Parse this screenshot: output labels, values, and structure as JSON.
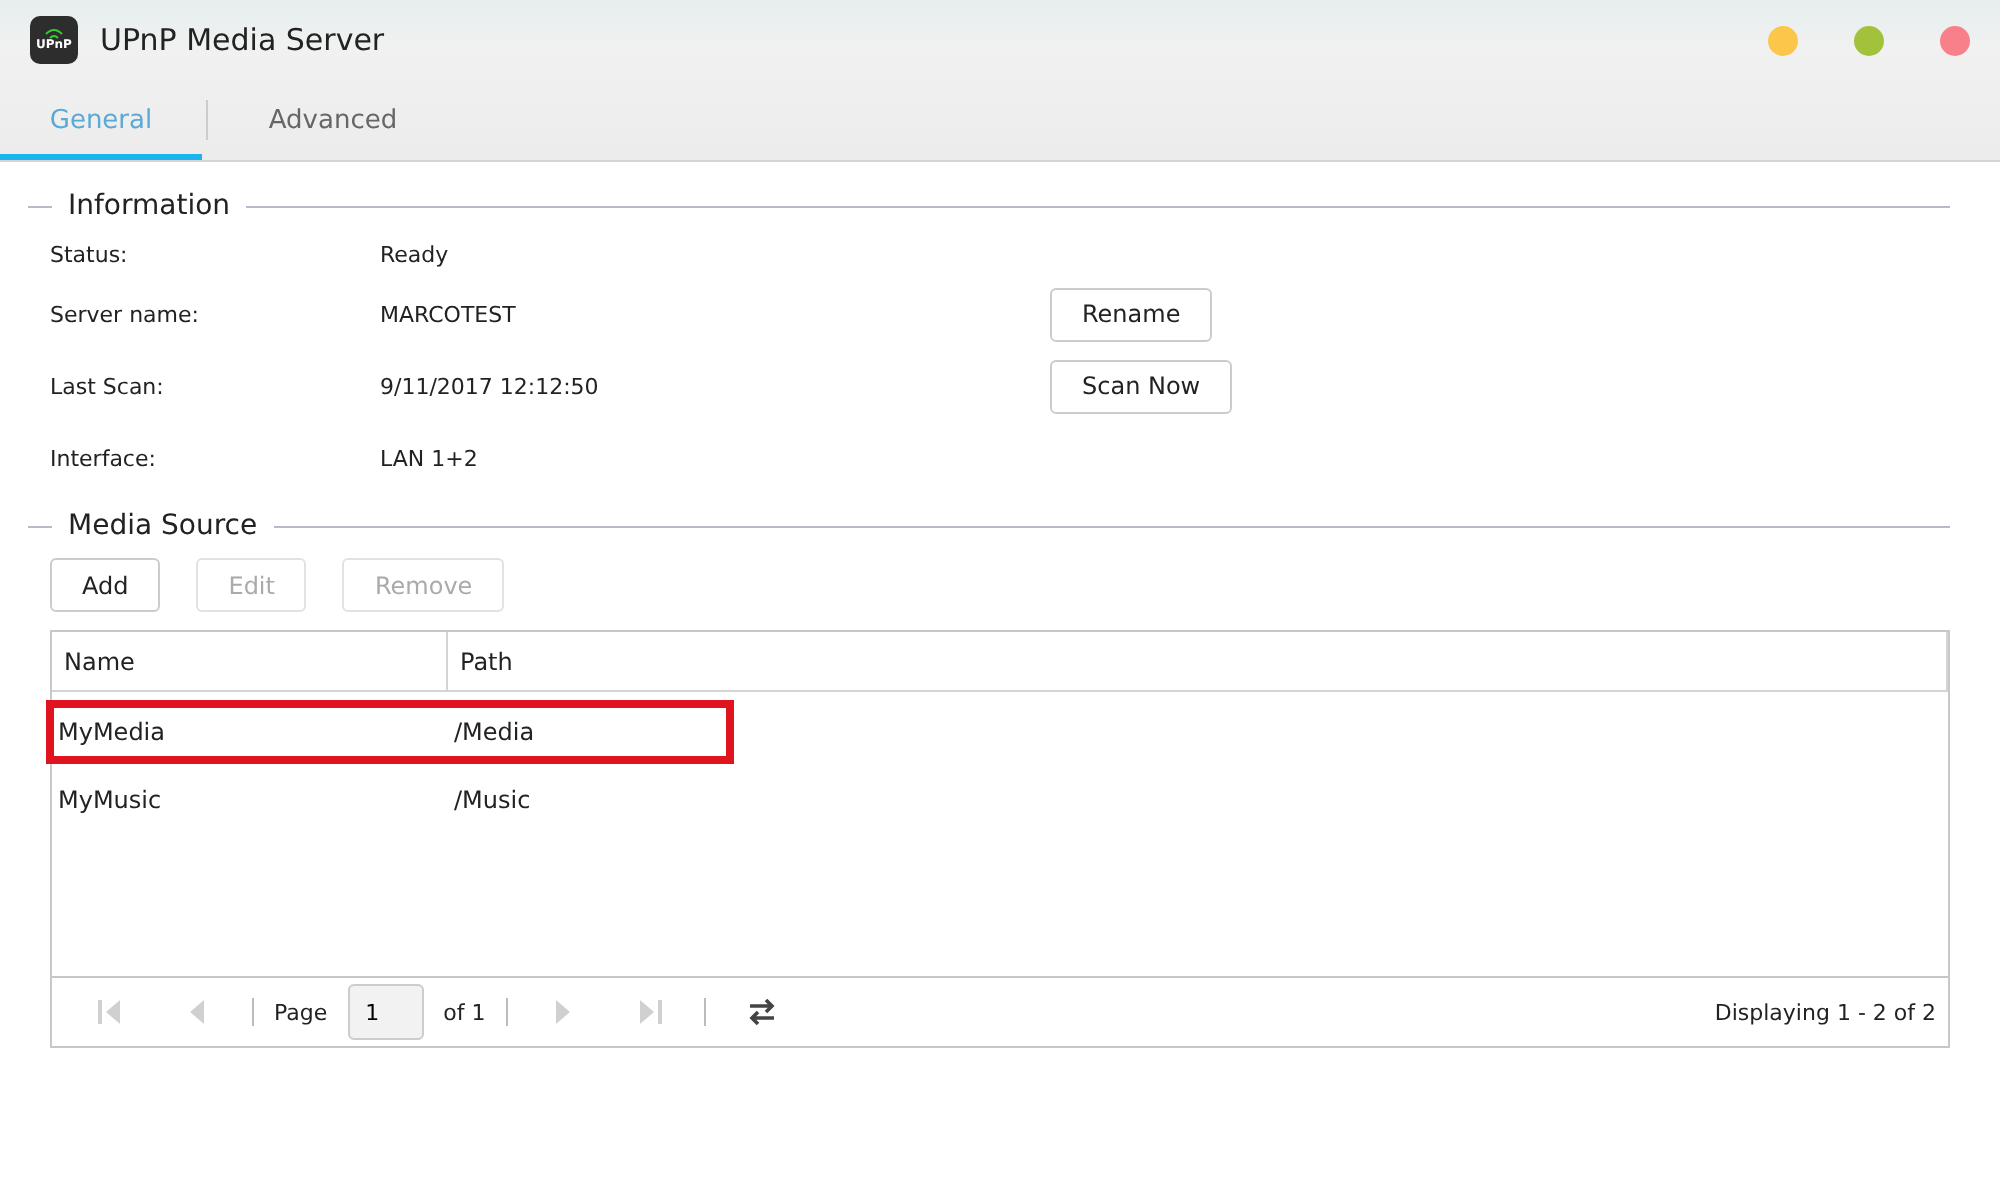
{
  "window": {
    "title": "UPnP Media Server",
    "app_icon_text": "UPnP"
  },
  "tabs": [
    {
      "label": "General",
      "selected": true
    },
    {
      "label": "Advanced",
      "selected": false
    }
  ],
  "information": {
    "title": "Information",
    "rows": [
      {
        "label": "Status:",
        "value": "Ready"
      },
      {
        "label": "Server name:",
        "value": "MARCOTEST",
        "button": "Rename"
      },
      {
        "label": "Last Scan:",
        "value": "9/11/2017 12:12:50",
        "button": "Scan Now"
      },
      {
        "label": "Interface:",
        "value": "LAN 1+2"
      }
    ]
  },
  "media_source": {
    "title": "Media Source",
    "buttons": [
      {
        "label": "Add",
        "disabled": false
      },
      {
        "label": "Edit",
        "disabled": true
      },
      {
        "label": "Remove",
        "disabled": true
      }
    ],
    "table": {
      "columns": [
        "Name",
        "Path"
      ],
      "rows": [
        {
          "name": "MyMedia",
          "path": "/Media",
          "highlighted": true
        },
        {
          "name": "MyMusic",
          "path": "/Music",
          "highlighted": false
        }
      ]
    },
    "pager": {
      "nav": [
        {
          "kind": "first",
          "disabled": true
        },
        {
          "kind": "prev",
          "disabled": true
        },
        {
          "kind": "next",
          "disabled": true
        },
        {
          "kind": "last",
          "disabled": true
        }
      ],
      "page_label": "Page",
      "page": "1",
      "of_label": "of 1",
      "display": "Displaying 1 - 2 of 2"
    }
  }
}
